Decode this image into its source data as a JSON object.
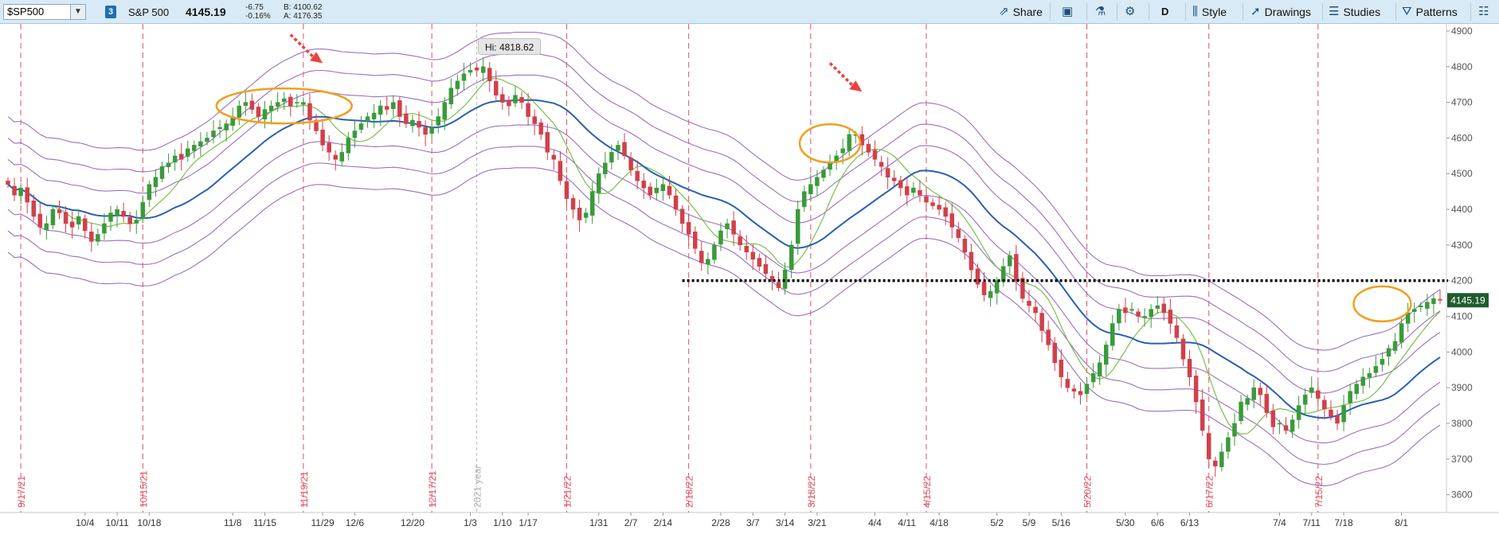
{
  "toolbar": {
    "symbol": "$SP500",
    "link_badge": "3",
    "name": "S&P 500",
    "last": "4145.19",
    "change": "-6.75",
    "change_pct": "-0.16%",
    "bid": "B: 4100.62",
    "ask": "A: 4176.35",
    "share_label": "Share",
    "timeframe": "D",
    "style_label": "Style",
    "drawings_label": "Drawings",
    "studies_label": "Studies",
    "patterns_label": "Patterns"
  },
  "chart_data": {
    "type": "candlestick",
    "symbol": "$SP500",
    "ylim": [
      3550,
      4920
    ],
    "y_ticks": [
      3600,
      3700,
      3800,
      3900,
      4000,
      4100,
      4200,
      4300,
      4400,
      4500,
      4600,
      4700,
      4800,
      4900
    ],
    "x_ticks": [
      "10/4",
      "10/11",
      "10/18",
      "11/8",
      "11/15",
      "11/29",
      "12/6",
      "12/20",
      "1/3",
      "1/10",
      "1/17",
      "1/31",
      "2/7",
      "2/14",
      "2/28",
      "3/7",
      "3/14",
      "3/21",
      "4/4",
      "4/11",
      "4/18",
      "5/2",
      "5/9",
      "5/16",
      "5/30",
      "6/6",
      "6/13",
      "7/4",
      "7/11",
      "7/18",
      "8/1"
    ],
    "x_tick_index": [
      12,
      17,
      22,
      35,
      40,
      49,
      54,
      63,
      72,
      77,
      81,
      92,
      97,
      102,
      111,
      116,
      121,
      126,
      135,
      140,
      145,
      154,
      159,
      164,
      174,
      179,
      184,
      198,
      203,
      208,
      217
    ],
    "event_lines": [
      {
        "label": "9/17/21",
        "index": 2
      },
      {
        "label": "10/15/21",
        "index": 21
      },
      {
        "label": "11/19/21",
        "index": 46
      },
      {
        "label": "12/17/21",
        "index": 66
      },
      {
        "label": "1/21/22",
        "index": 87
      },
      {
        "label": "2/18/22",
        "index": 106
      },
      {
        "label": "3/18/22",
        "index": 125
      },
      {
        "label": "4/15/22",
        "index": 143
      },
      {
        "label": "5/20/22",
        "index": 168
      },
      {
        "label": "6/17/22",
        "index": 187
      },
      {
        "label": "7/15/22",
        "index": 204
      }
    ],
    "year_label": "2021 year",
    "year_index": 73,
    "hi_label": "Hi: 4818.62",
    "hi_value": 4818.62,
    "price_label": "4145.19",
    "price_value": 4145.19,
    "horizontal_level": 4200,
    "colors": {
      "up": "#3a9a3a",
      "down": "#d0404a",
      "ma_blue": "#2a60b0",
      "ma_green": "#7ac04a",
      "envelope": "#9b6fc0",
      "event_line": "#e05060",
      "highlight": "#f0a020",
      "arrow": "#f04040"
    },
    "closes": [
      4470,
      4440,
      4460,
      4420,
      4380,
      4350,
      4360,
      4400,
      4390,
      4360,
      4350,
      4380,
      4340,
      4310,
      4330,
      4360,
      4390,
      4400,
      4380,
      4360,
      4370,
      4420,
      4470,
      4490,
      4520,
      4530,
      4550,
      4540,
      4570,
      4580,
      4590,
      4600,
      4620,
      4630,
      4640,
      4660,
      4690,
      4700,
      4680,
      4660,
      4680,
      4690,
      4700,
      4710,
      4690,
      4700,
      4700,
      4650,
      4620,
      4580,
      4560,
      4540,
      4560,
      4600,
      4620,
      4640,
      4660,
      4670,
      4690,
      4680,
      4700,
      4660,
      4640,
      4650,
      4630,
      4610,
      4630,
      4660,
      4700,
      4740,
      4760,
      4780,
      4790,
      4790,
      4800,
      4760,
      4720,
      4700,
      4690,
      4720,
      4700,
      4660,
      4640,
      4610,
      4560,
      4540,
      4480,
      4430,
      4400,
      4370,
      4390,
      4450,
      4500,
      4530,
      4560,
      4580,
      4550,
      4510,
      4480,
      4460,
      4440,
      4460,
      4470,
      4440,
      4400,
      4360,
      4330,
      4290,
      4250,
      4260,
      4300,
      4340,
      4360,
      4330,
      4300,
      4280,
      4260,
      4240,
      4220,
      4200,
      4180,
      4230,
      4300,
      4400,
      4450,
      4470,
      4490,
      4510,
      4530,
      4550,
      4570,
      4610,
      4610,
      4580,
      4560,
      4540,
      4520,
      4490,
      4480,
      4460,
      4440,
      4460,
      4440,
      4420,
      4410,
      4400,
      4380,
      4350,
      4320,
      4280,
      4230,
      4190,
      4160,
      4170,
      4200,
      4240,
      4270,
      4200,
      4150,
      4130,
      4110,
      4060,
      4020,
      3970,
      3930,
      3900,
      3890,
      3880,
      3910,
      3940,
      3970,
      4020,
      4080,
      4120,
      4110,
      4120,
      4100,
      4100,
      4120,
      4130,
      4110,
      4080,
      4040,
      3980,
      3930,
      3860,
      3780,
      3700,
      3680,
      3720,
      3760,
      3800,
      3860,
      3870,
      3900,
      3880,
      3830,
      3790,
      3800,
      3780,
      3810,
      3850,
      3880,
      3900,
      3870,
      3840,
      3820,
      3800,
      3850,
      3890,
      3910,
      3930,
      3940,
      3960,
      3980,
      4010,
      4030,
      4080,
      4110,
      4120,
      4130,
      4140,
      4150,
      4145
    ]
  }
}
